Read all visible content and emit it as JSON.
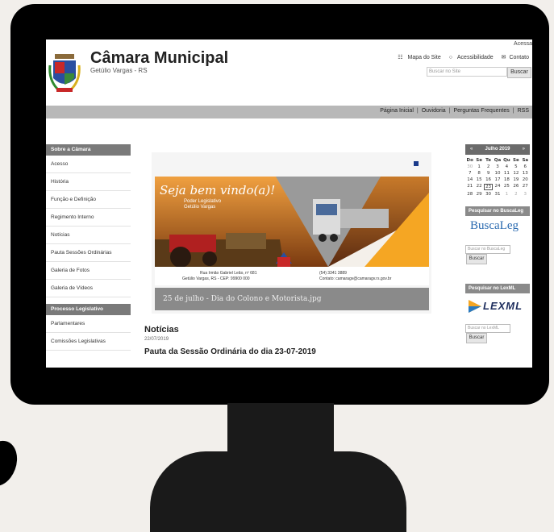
{
  "header": {
    "title": "Câmara Municipal",
    "subtitle": "Getúlio Vargas - RS",
    "access_link": "Acessa",
    "utility_links": {
      "sitemap": "Mapa do Site",
      "accessibility": "Acessibilidade",
      "contact": "Contato"
    },
    "search": {
      "placeholder": "Buscar no Site",
      "button": "Buscar"
    }
  },
  "navbar": {
    "links": [
      "Página Inicial",
      "Ouvidoria",
      "Perguntas Frequentes",
      "RSS"
    ]
  },
  "sidebar": {
    "sections": [
      {
        "heading": "Sobre a Câmara",
        "items": [
          "Acesso",
          "História",
          "Função e Definição",
          "Regimento Interno",
          "Notícias",
          "Pauta Sessões Ordinárias",
          "Galeria de Fotos",
          "Galeria de Vídeos"
        ]
      },
      {
        "heading": "Processo Legislativo",
        "items": [
          "Parlamentares",
          "Comissões Legislativas"
        ]
      }
    ]
  },
  "banner": {
    "greeting": "Seja bem vindo(a)!",
    "power": "Poder Legislativo",
    "city": "Getúlio Vargas",
    "address": "Rua Irmão Gabriel Leão, nº 681",
    "address2": "Getúlio Vargas, RS - CEP: 99900 000",
    "phone": "(54) 3341 3889",
    "contact": "Contato: camaragv@camaragv.rs.gov.br",
    "caption": "25 de julho - Dia do Colono e Motorista.jpg"
  },
  "news": {
    "section_title": "Notícias",
    "date": "22/07/2019",
    "headline": "Pauta da Sessão Ordinária do dia 23-07-2019"
  },
  "calendar": {
    "prev": "«",
    "next": "»",
    "month": "Julho 2019",
    "weekdays": [
      "Do",
      "Se",
      "Te",
      "Qa",
      "Qu",
      "Se",
      "Sa"
    ],
    "days": [
      [
        "30",
        "1",
        "2",
        "3",
        "4",
        "5",
        "6"
      ],
      [
        "7",
        "8",
        "9",
        "10",
        "11",
        "12",
        "13"
      ],
      [
        "14",
        "15",
        "16",
        "17",
        "18",
        "19",
        "20"
      ],
      [
        "21",
        "22",
        "23",
        "24",
        "25",
        "26",
        "27"
      ],
      [
        "28",
        "29",
        "30",
        "31",
        "1",
        "2",
        "3"
      ]
    ],
    "today": "23"
  },
  "buscaleg": {
    "heading": "Pesquisar no BuscaLeg",
    "logo": "BuscaLeg",
    "placeholder": "Buscar no BuscaLeg",
    "button": "Buscar"
  },
  "lexml": {
    "heading": "Pesquisar no LexML",
    "logo": "LEXML",
    "placeholder": "Buscar no LexML",
    "button": "Buscar"
  },
  "colors": {
    "monitor": "#000000",
    "background": "#f2efeb",
    "navbar": "#b8b8b8",
    "sidebar_heading": "#7a7a7a",
    "accent_orange": "#f5a623",
    "lexml_blue": "#1e2e5e"
  }
}
